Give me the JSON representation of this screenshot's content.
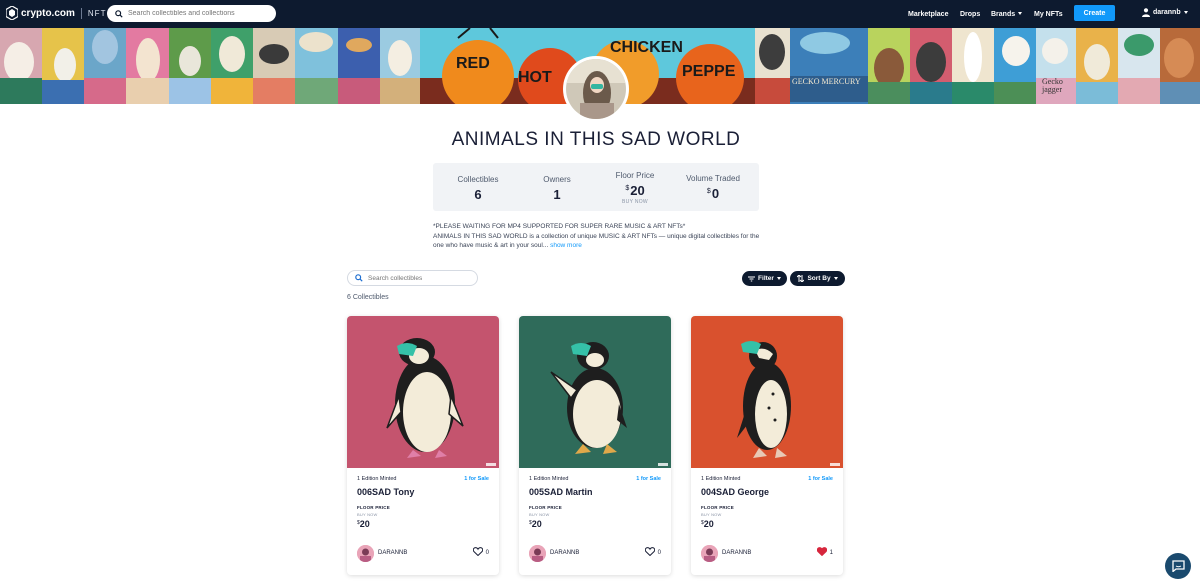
{
  "brand": {
    "name": "crypto.com",
    "product": "NFT"
  },
  "top_search": {
    "placeholder": "Search collectibles and collections"
  },
  "nav": {
    "marketplace": "Marketplace",
    "drops": "Drops",
    "brands": "Brands",
    "my_nfts": "My NFTs",
    "create": "Create",
    "username": "darannb"
  },
  "collection": {
    "title": "ANIMALS IN THIS SAD WORLD",
    "stats": {
      "collectibles_label": "Collectibles",
      "collectibles_value": "6",
      "owners_label": "Owners",
      "owners_value": "1",
      "floor_label": "Floor Price",
      "floor_currency": "$",
      "floor_value": "20",
      "floor_sub": "BUY NOW",
      "volume_label": "Volume Traded",
      "volume_currency": "$",
      "volume_value": "0"
    },
    "description_line1": "*PLEASE WAITING FOR MP4 SUPPORTED FOR SUPER RARE MUSIC & ART NFTs*",
    "description_line2": "ANIMALS IN THIS SAD WORLD is a collection of unique MUSIC & ART NFTs — unique digital collectibles for the one who have music & art in your soul...",
    "show_more": "show more"
  },
  "toolbar": {
    "search_placeholder": "Search collectibles",
    "filter": "Filter",
    "sort": "Sort By",
    "count": "6 Collectibles"
  },
  "cards": [
    {
      "edition": "1 Edition Minted",
      "sale": "1 for Sale",
      "name": "006SAD Tony",
      "floor_label": "FLOOR PRICE",
      "buy_now": "BUY NOW",
      "currency": "$",
      "price": "20",
      "creator": "DARANNB",
      "likes": "0",
      "liked": false,
      "bg": "#c4546e"
    },
    {
      "edition": "1 Edition Minted",
      "sale": "1 for Sale",
      "name": "005SAD Martin",
      "floor_label": "FLOOR PRICE",
      "buy_now": "BUY NOW",
      "currency": "$",
      "price": "20",
      "creator": "DARANNB",
      "likes": "0",
      "liked": false,
      "bg": "#2f6b5a"
    },
    {
      "edition": "1 Edition Minted",
      "sale": "1 for Sale",
      "name": "004SAD George",
      "floor_label": "FLOOR PRICE",
      "buy_now": "BUY NOW",
      "currency": "$",
      "price": "20",
      "creator": "DARANNB",
      "likes": "1",
      "liked": true,
      "bg": "#d9512e"
    }
  ],
  "banner_text": [
    "RED",
    "HOT",
    "CHICKEN",
    "PEPPE",
    "GECKO MERCURY",
    "Gecko jagger"
  ],
  "colors": {
    "navbar": "#0d1a2f",
    "accent": "#1199fa",
    "heart_liked": "#d7263d"
  }
}
